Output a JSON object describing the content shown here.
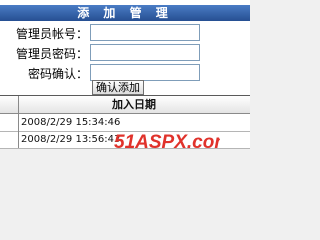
{
  "form": {
    "title": "添 加 管 理",
    "fields": [
      {
        "label": "管理员帐号：",
        "value": ""
      },
      {
        "label": "管理员密码：",
        "value": ""
      },
      {
        "label": "密码确认：",
        "value": ""
      }
    ],
    "submit_label": "确认添加"
  },
  "table": {
    "columns": [
      "加入日期"
    ],
    "rows": [
      {
        "date": "2008/2/29 15:34:46"
      },
      {
        "date": "2008/2/29 13:56:43"
      }
    ]
  },
  "watermark": {
    "text": "51ASPX.com"
  },
  "colors": {
    "header_blue": "#2f5ea5",
    "watermark_red": "#e0322b"
  }
}
